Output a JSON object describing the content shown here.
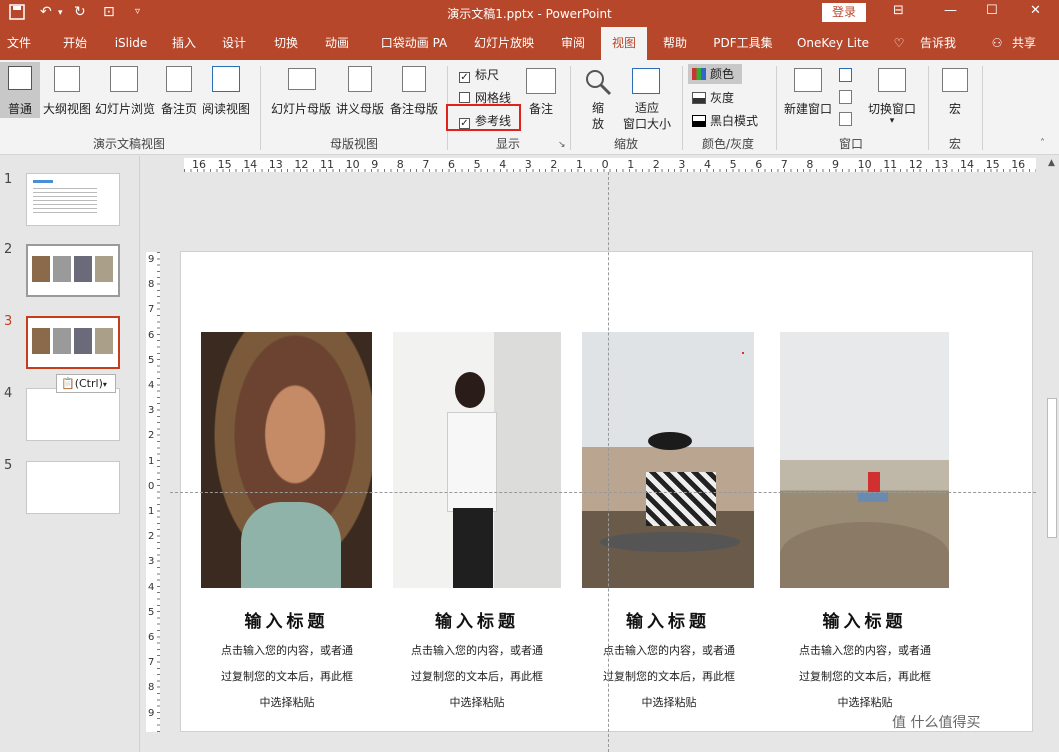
{
  "titlebar": {
    "title": "演示文稿1.pptx - PowerPoint",
    "login": "登录",
    "save_icon": "save-icon",
    "undo_icon": "undo-icon"
  },
  "tabs": [
    "文件",
    "开始",
    "iSlide",
    "插入",
    "设计",
    "切换",
    "动画",
    "口袋动画 PA",
    "幻灯片放映",
    "审阅",
    "视图",
    "帮助",
    "PDF工具集",
    "OneKey Lite",
    "告诉我",
    "共享"
  ],
  "ribbon": {
    "views": {
      "normal": "普通",
      "outline": "大纲视图",
      "sorter": "幻灯片浏览",
      "notes_page": "备注页",
      "reading": "阅读视图",
      "group": "演示文稿视图"
    },
    "master": {
      "slide_master": "幻灯片母版",
      "handout_master": "讲义母版",
      "notes_master": "备注母版",
      "group": "母版视图"
    },
    "show": {
      "ruler": "标尺",
      "gridlines": "网格线",
      "guides": "参考线",
      "notes": "备注",
      "group": "显示"
    },
    "zoom": {
      "zoom1": "缩",
      "zoom2": "放",
      "fit1": "适应",
      "fit2": "窗口大小",
      "group": "缩放"
    },
    "color": {
      "color": "颜色",
      "gray": "灰度",
      "bw": "黑白模式",
      "group": "颜色/灰度"
    },
    "window": {
      "new": "新建窗口",
      "switch": "切换窗口",
      "group": "窗口"
    },
    "macro": {
      "macro": "宏",
      "group": "宏"
    }
  },
  "slides": [
    "1",
    "2",
    "3",
    "4",
    "5"
  ],
  "paste_option": "(Ctrl)",
  "ruler": {
    "h": [
      "16",
      "15",
      "14",
      "13",
      "12",
      "11",
      "10",
      "9",
      "8",
      "7",
      "6",
      "5",
      "4",
      "3",
      "2",
      "1",
      "0",
      "1",
      "2",
      "3",
      "4",
      "5",
      "6",
      "7",
      "8",
      "9",
      "10",
      "11",
      "12",
      "13",
      "14",
      "15",
      "16"
    ],
    "v": [
      "9",
      "8",
      "7",
      "6",
      "5",
      "4",
      "3",
      "2",
      "1",
      "0",
      "1",
      "2",
      "3",
      "4",
      "5",
      "6",
      "7",
      "8",
      "9"
    ]
  },
  "cards": [
    {
      "title": "输入标题",
      "line1": "点击输入您的内容，或者通",
      "line2": "过复制您的文本后，再此框",
      "line3": "中选择粘贴"
    },
    {
      "title": "输入标题",
      "line1": "点击输入您的内容，或者通",
      "line2": "过复制您的文本后，再此框",
      "line3": "中选择粘贴"
    },
    {
      "title": "输入标题",
      "line1": "点击输入您的内容，或者通",
      "line2": "过复制您的文本后，再此框",
      "line3": "中选择粘贴"
    },
    {
      "title": "输入标题",
      "line1": "点击输入您的内容，或者通",
      "line2": "过复制您的文本后，再此框",
      "line3": "中选择粘贴"
    }
  ],
  "watermark": "值 什么值得买"
}
